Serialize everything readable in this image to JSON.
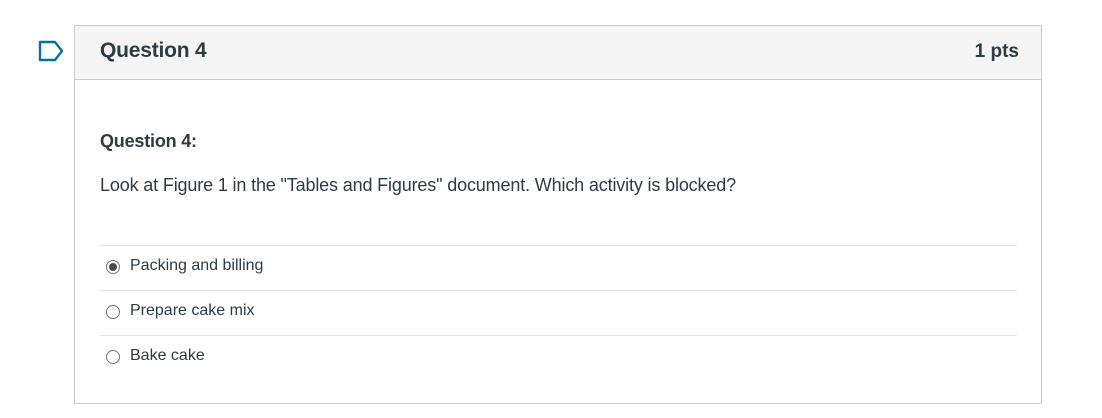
{
  "question": {
    "title": "Question 4",
    "points": "1 pts",
    "subtitle": "Question 4:",
    "text": "Look at Figure 1 in the \"Tables and Figures\" document. Which activity is blocked?",
    "flag_icon": "flag-question-icon",
    "selected_index": 0,
    "answers": [
      {
        "label": "Packing and billing",
        "selected": true
      },
      {
        "label": "Prepare cake mix",
        "selected": false
      },
      {
        "label": "Bake cake",
        "selected": false
      }
    ]
  },
  "colors": {
    "text": "#2d3b45",
    "header_bg": "#f5f5f5",
    "border": "#c7cdd1",
    "flag": "#0770a3"
  }
}
